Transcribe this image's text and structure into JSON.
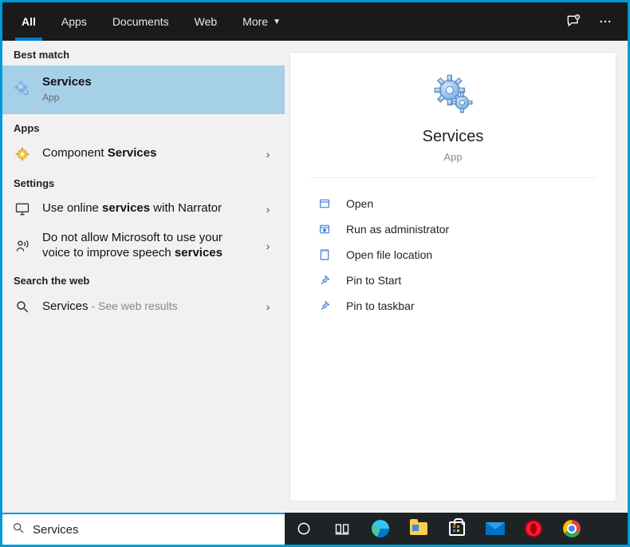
{
  "tabs": {
    "all": "All",
    "apps": "Apps",
    "documents": "Documents",
    "web": "Web",
    "more": "More"
  },
  "groups": {
    "best_match": "Best match",
    "apps": "Apps",
    "settings": "Settings",
    "web": "Search the web"
  },
  "results": {
    "best": {
      "title": "Services",
      "sub": "App"
    },
    "component": {
      "prefix": "Component ",
      "bold": "Services"
    },
    "narrator": {
      "p1": "Use online ",
      "b1": "services",
      "p2": " with Narrator"
    },
    "voice": {
      "p1": "Do not allow Microsoft to use your voice to improve speech ",
      "b1": "services"
    },
    "websearch": {
      "p1": "Services",
      "p2": " - ",
      "grey": "See web results"
    }
  },
  "detail": {
    "title": "Services",
    "sub": "App",
    "actions": {
      "open": "Open",
      "admin": "Run as administrator",
      "location": "Open file location",
      "pin_start": "Pin to Start",
      "pin_taskbar": "Pin to taskbar"
    }
  },
  "search": {
    "value": "Services"
  }
}
